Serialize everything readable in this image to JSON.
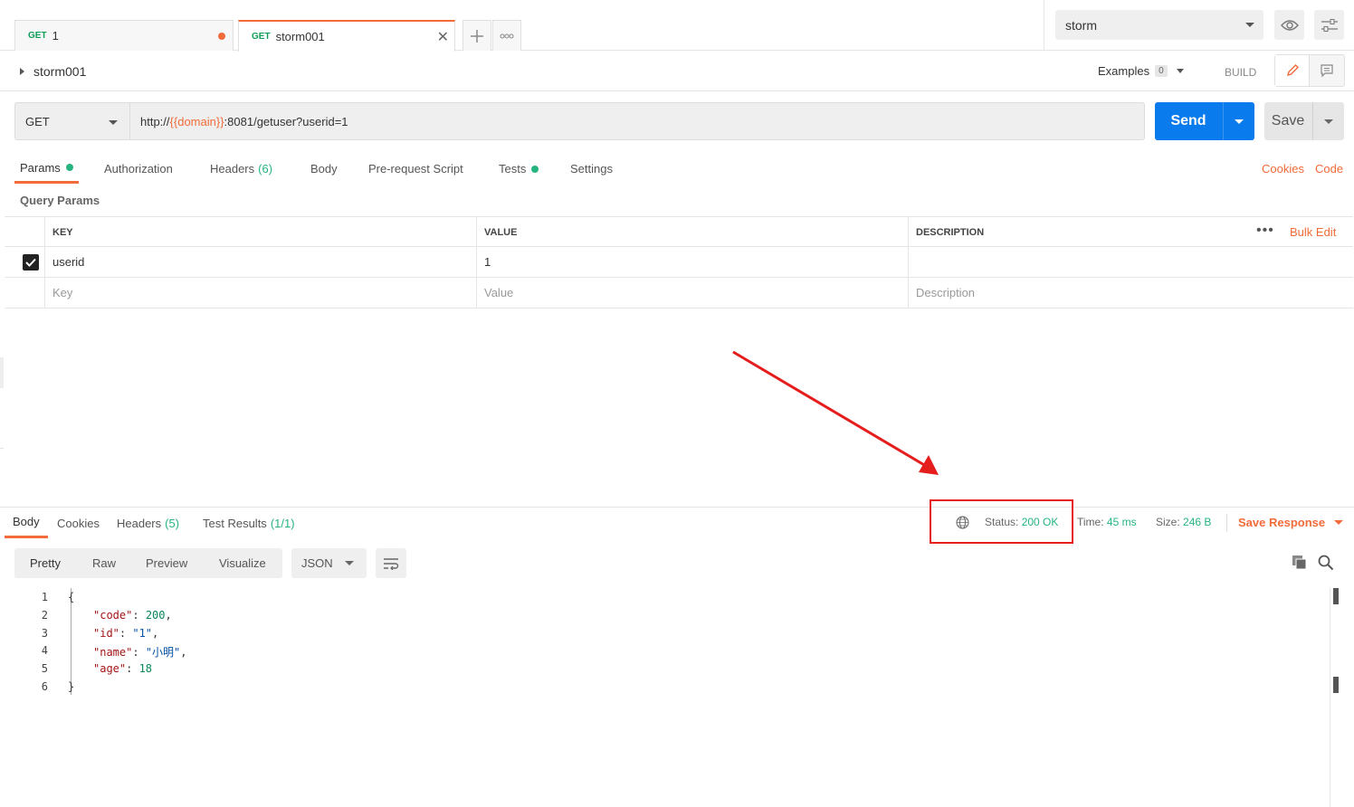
{
  "tabs": [
    {
      "method": "GET",
      "name": "1",
      "unsaved": true
    },
    {
      "method": "GET",
      "name": "storm001",
      "active": true
    }
  ],
  "environment": {
    "selected": "storm"
  },
  "request": {
    "name": "storm001",
    "examples_label": "Examples",
    "examples_count": "0",
    "build_label": "BUILD",
    "method": "GET",
    "url_prefix": "http://",
    "url_var": "{{domain}}",
    "url_suffix": ":8081/getuser?userid=1",
    "send_label": "Send",
    "save_label": "Save"
  },
  "request_tabs": [
    {
      "label": "Params",
      "dot": true
    },
    {
      "label": "Authorization"
    },
    {
      "label": "Headers",
      "count": "(6)"
    },
    {
      "label": "Body"
    },
    {
      "label": "Pre-request Script"
    },
    {
      "label": "Tests",
      "dot": true
    },
    {
      "label": "Settings"
    }
  ],
  "links": {
    "cookies": "Cookies",
    "code": "Code"
  },
  "query_params": {
    "title": "Query Params",
    "headers": [
      "KEY",
      "VALUE",
      "DESCRIPTION"
    ],
    "bulk_edit": "Bulk Edit",
    "rows": [
      {
        "key": "userid",
        "value": "1",
        "description": "",
        "checked": true
      }
    ],
    "placeholders": {
      "key": "Key",
      "value": "Value",
      "description": "Description"
    }
  },
  "response_tabs": [
    {
      "label": "Body"
    },
    {
      "label": "Cookies"
    },
    {
      "label": "Headers",
      "count": "(5)"
    },
    {
      "label": "Test Results",
      "count": "(1/1)"
    }
  ],
  "response_meta": {
    "status_label": "Status:",
    "status_value": "200 OK",
    "time_label": "Time:",
    "time_value": "45 ms",
    "size_label": "Size:",
    "size_value": "246 B",
    "save_response": "Save Response"
  },
  "body_view": {
    "options": [
      "Pretty",
      "Raw",
      "Preview",
      "Visualize"
    ],
    "format": "JSON"
  },
  "response_body": {
    "line_numbers": [
      "1",
      "2",
      "3",
      "4",
      "5",
      "6"
    ],
    "open_brace": "{",
    "close_brace": "}",
    "fields": [
      {
        "key": "\"code\"",
        "value": "200",
        "type": "number",
        "comma": ","
      },
      {
        "key": "\"id\"",
        "value": "\"1\"",
        "type": "string",
        "comma": ","
      },
      {
        "key": "\"name\"",
        "value": "\"小明\"",
        "type": "string",
        "comma": ","
      },
      {
        "key": "\"age\"",
        "value": "18",
        "type": "number",
        "comma": ""
      }
    ]
  },
  "colors": {
    "accent": "#f26b3a",
    "send": "#097bed",
    "success": "#26b47f",
    "annotation": "#e51d1d"
  }
}
